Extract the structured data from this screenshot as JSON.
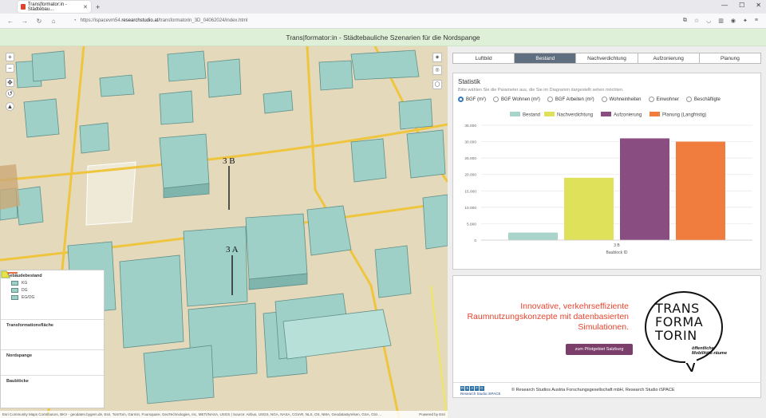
{
  "browser": {
    "tab_title": "Trans|formator:in - Städtebau...",
    "tab_close": "✕",
    "new_tab": "+",
    "url_prefix": "https://ispacevm54.",
    "url_host": "researchstudio.at",
    "url_path": "/transformatorin_3D_04062024/index.html",
    "win_min": "—",
    "win_max": "☐",
    "win_close": "✕"
  },
  "app": {
    "title": "Trans|formator:in - Städtebauliche Szenarien für die Nordspange"
  },
  "map": {
    "labels": [
      "3 B",
      "3 A"
    ],
    "zoom_in": "+",
    "zoom_out": "−",
    "legend": {
      "buildings_title": "Gebäudebestand",
      "building_items": [
        "KG",
        "DG",
        "EG/OG"
      ],
      "transformation_title": "Transformationsfläche",
      "nordspange_title": "Nordspange",
      "baubloecke_title": "Baublöcke"
    },
    "attribution": "Esri Community Maps Contributors, BKV - geodaten.bygem.de, Esri, TomTom, Garmin, Foursquare, GeoTechnologies, Inc, METI/NASA, USGS | Source: Airbus, USGS, NGA, NASA, CGIAR, NLS, OS, NMA, Geodatastyrelsen, GSA, GSI ...",
    "powered_by": "Powered by Esri"
  },
  "tabs": [
    "Luftbild",
    "Bestand",
    "Nachverdichtung",
    "Aufzonierung",
    "Planung"
  ],
  "active_tab": "Bestand",
  "stats": {
    "title": "Statistik",
    "subtitle": "Bitte wählen Sie die Parameter aus, die Sie im Diagramm dargestellt sehen möchten.",
    "options": [
      "BGF (m²)",
      "BGF Wohnen (m²)",
      "BGF Arbeiten (m²)",
      "Wohneinheiten",
      "Einwohner",
      "Beschäftigte"
    ],
    "selected": "BGF (m²)"
  },
  "chart_data": {
    "type": "bar",
    "categories": [
      "3 B"
    ],
    "series": [
      {
        "name": "Bestand",
        "color": "#a9d4cc",
        "values": [
          2300
        ]
      },
      {
        "name": "Nachverdichtung",
        "color": "#dfe15a",
        "values": [
          19000
        ]
      },
      {
        "name": "Aufzonierung",
        "color": "#8a4d82",
        "values": [
          31000
        ]
      },
      {
        "name": "Planung (Langfristig)",
        "color": "#f07c3d",
        "values": [
          30000
        ]
      }
    ],
    "xlabel": "Baublock ID",
    "ylabel": "",
    "ylim": [
      0,
      35000
    ],
    "yticks": [
      "0",
      "5.000",
      "10.000",
      "15.000",
      "20.000",
      "25.000",
      "30.000",
      "35.000"
    ],
    "legend_position": "top",
    "grid": true
  },
  "promo": {
    "headline": "Innovative, verkehrseffiziente Raumnutzungskonzepte mit datenbasierten Simulationen.",
    "button": "zum Pilotgebiet Salzburg",
    "logo_lines": [
      "TRANS",
      "FORMA",
      "TORIN"
    ],
    "logo_sub": "öffentlicher Mobilitäts-räume"
  },
  "footer": {
    "logo_boxes": [
      "R",
      "S",
      "A",
      "F",
      "G"
    ],
    "logo_caption": "Research Studio iSPACE",
    "copyright": "© Research Studios Austria Forschungsgesellschaft mbH, Research Studio iSPACE"
  }
}
